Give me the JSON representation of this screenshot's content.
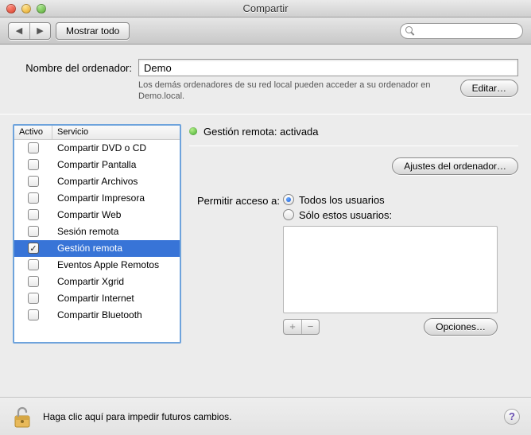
{
  "window": {
    "title": "Compartir"
  },
  "toolbar": {
    "back": "◀",
    "forward": "▶",
    "show_all": "Mostrar todo",
    "search_placeholder": ""
  },
  "computer_name": {
    "label": "Nombre del ordenador:",
    "value": "Demo",
    "hint": "Los demás ordenadores de su red local pueden acceder a su ordenador en Demo.local.",
    "edit_btn": "Editar…"
  },
  "services": {
    "header_active": "Activo",
    "header_service": "Servicio",
    "items": [
      {
        "label": "Compartir DVD o CD",
        "checked": false,
        "selected": false
      },
      {
        "label": "Compartir Pantalla",
        "checked": false,
        "selected": false
      },
      {
        "label": "Compartir Archivos",
        "checked": false,
        "selected": false
      },
      {
        "label": "Compartir Impresora",
        "checked": false,
        "selected": false
      },
      {
        "label": "Compartir Web",
        "checked": false,
        "selected": false
      },
      {
        "label": "Sesión remota",
        "checked": false,
        "selected": false
      },
      {
        "label": "Gestión remota",
        "checked": true,
        "selected": true
      },
      {
        "label": "Eventos Apple Remotos",
        "checked": false,
        "selected": false
      },
      {
        "label": "Compartir Xgrid",
        "checked": false,
        "selected": false
      },
      {
        "label": "Compartir Internet",
        "checked": false,
        "selected": false
      },
      {
        "label": "Compartir Bluetooth",
        "checked": false,
        "selected": false
      }
    ]
  },
  "detail": {
    "status": "Gestión remota: activada",
    "computer_settings_btn": "Ajustes del ordenador…",
    "allow_label": "Permitir acceso a:",
    "radio_all": "Todos los usuarios",
    "radio_only": "Sólo estos usuarios:",
    "radio_selected": "all",
    "plus": "+",
    "minus": "−",
    "options_btn": "Opciones…"
  },
  "footer": {
    "lock_text": "Haga clic aquí para impedir futuros cambios.",
    "help": "?"
  }
}
